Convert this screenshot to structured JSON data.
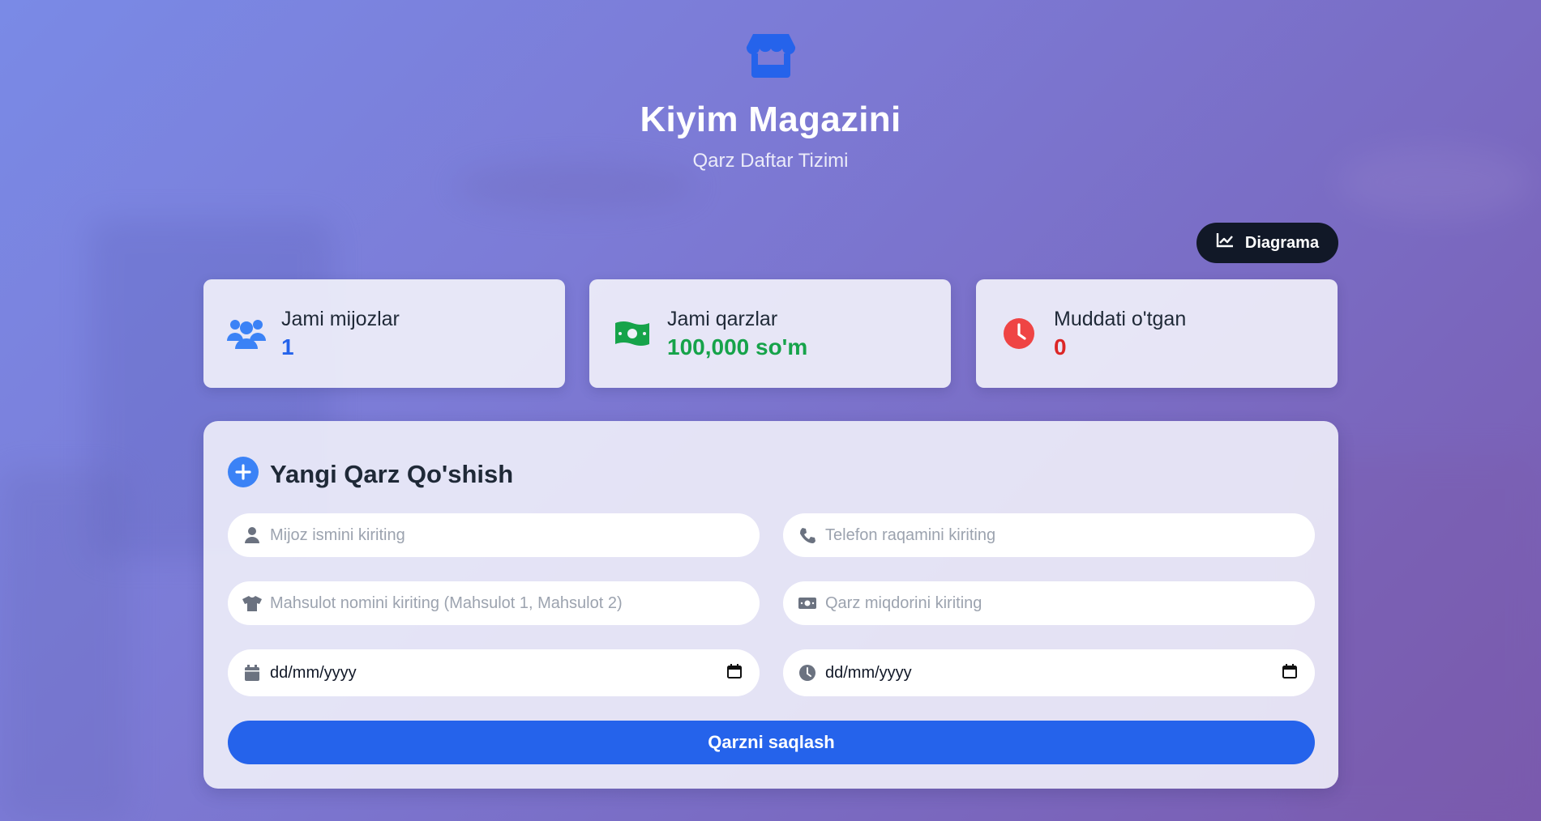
{
  "header": {
    "icon": "store-icon",
    "title": "Kiyim Magazini",
    "subtitle": "Qarz Daftar Tizimi"
  },
  "diagram_button": {
    "label": "Diagrama",
    "icon": "chart-line-icon"
  },
  "stats": [
    {
      "label": "Jami mijozlar",
      "value": "1",
      "icon": "users-icon",
      "color": "#2563eb"
    },
    {
      "label": "Jami qarzlar",
      "value": "100,000 so'm",
      "icon": "money-bill-icon",
      "color": "#16a34a"
    },
    {
      "label": "Muddati o'tgan",
      "value": "0",
      "icon": "clock-icon",
      "color": "#dc2626"
    }
  ],
  "form": {
    "title": "Yangi Qarz Qo'shish",
    "fields": {
      "name_placeholder": "Mijoz ismini kiriting",
      "phone_placeholder": "Telefon raqamini kiriting",
      "product_placeholder": "Mahsulot nomini kiriting (Mahsulot 1, Mahsulot 2)",
      "amount_placeholder": "Qarz miqdorini kiriting",
      "date_value": "dd/mm/yyyy",
      "due_date_value": "dd/mm/yyyy"
    },
    "save_label": "Qarzni saqlash"
  },
  "colors": {
    "accent": "#2563eb",
    "dark_button": "#111827"
  }
}
